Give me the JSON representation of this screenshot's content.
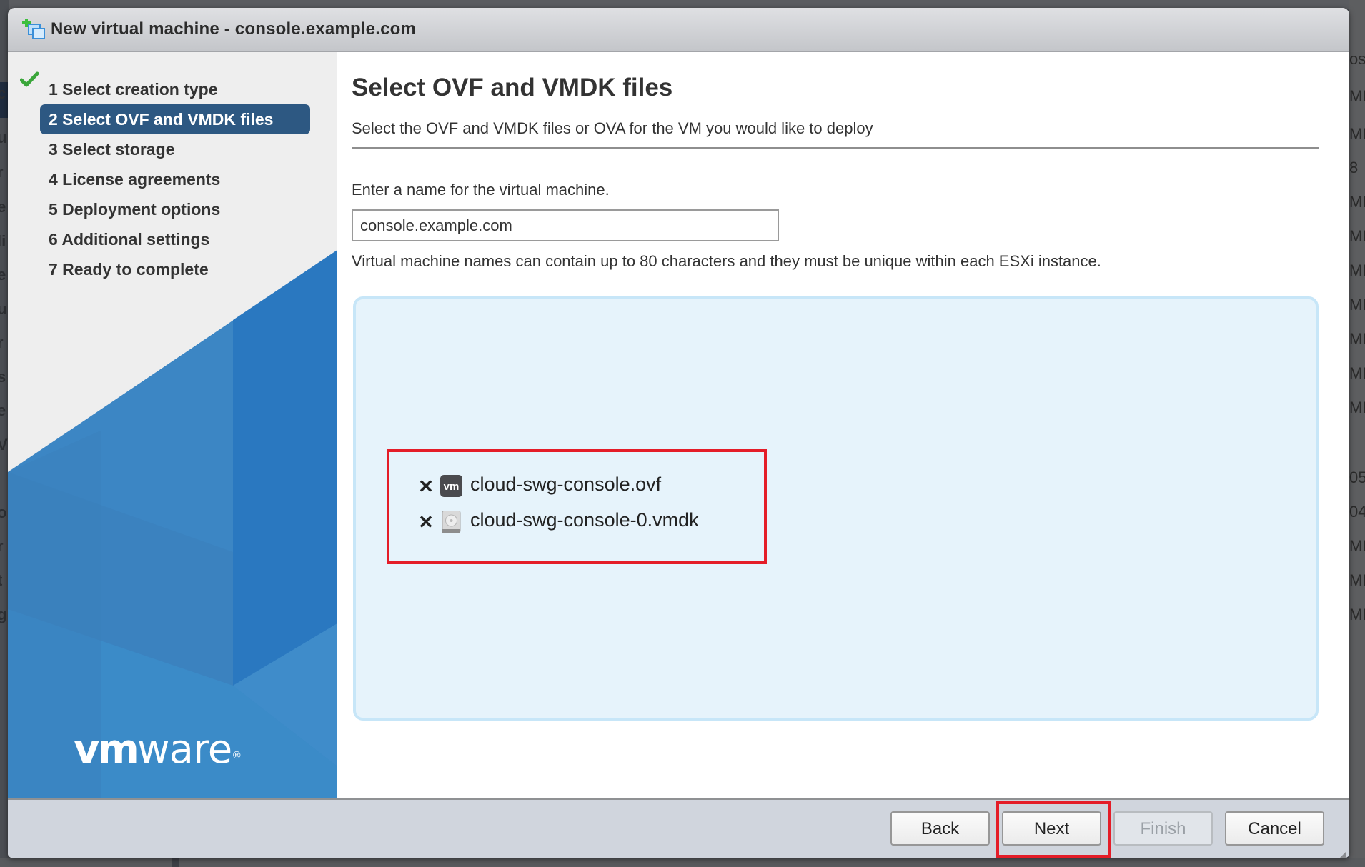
{
  "dialog": {
    "title": "New virtual machine - console.example.com",
    "title_icon": "new-vm-icon"
  },
  "sidebar": {
    "steps": [
      {
        "label": "1 Select creation type",
        "state": "completed"
      },
      {
        "label": "2 Select OVF and VMDK files",
        "state": "active"
      },
      {
        "label": "3 Select storage",
        "state": "pending"
      },
      {
        "label": "4 License agreements",
        "state": "pending"
      },
      {
        "label": "5 Deployment options",
        "state": "pending"
      },
      {
        "label": "6 Additional settings",
        "state": "pending"
      },
      {
        "label": "7 Ready to complete",
        "state": "pending"
      }
    ],
    "logo": {
      "bold": "vm",
      "light": "ware",
      "mark": "®"
    }
  },
  "main": {
    "title": "Select OVF and VMDK files",
    "subtitle": "Select the OVF and VMDK files or OVA for the VM you would like to deploy",
    "name_label": "Enter a name for the virtual machine.",
    "name_value": "console.example.com",
    "name_hint": "Virtual machine names can contain up to 80 characters and they must be unique within each ESXi instance.",
    "files": [
      {
        "name": "cloud-swg-console.ovf",
        "icon": "vm-file-icon",
        "remove": "✕"
      },
      {
        "name": "cloud-swg-console-0.vmdk",
        "icon": "disk-file-icon",
        "remove": "✕"
      }
    ]
  },
  "footer": {
    "back": "Back",
    "next": "Next",
    "finish": "Finish",
    "cancel": "Cancel"
  },
  "colors": {
    "accent": "#2d5882",
    "highlight": "#e41d28",
    "dropzone": "#e6f3fb",
    "check": "#3aa63a"
  },
  "background": {
    "left_fragments": [
      "c",
      "u",
      "r",
      "e",
      "li",
      "e",
      "u",
      "r",
      "s",
      "e",
      "V",
      "o",
      "r",
      "t",
      "g"
    ],
    "right_fragments": [
      "ost",
      "MI",
      "MI",
      "8",
      "MI",
      "MI",
      "MI",
      "MI",
      "MI",
      "MI",
      "MI",
      "05",
      "04",
      "MI",
      "MI",
      "MI"
    ]
  }
}
